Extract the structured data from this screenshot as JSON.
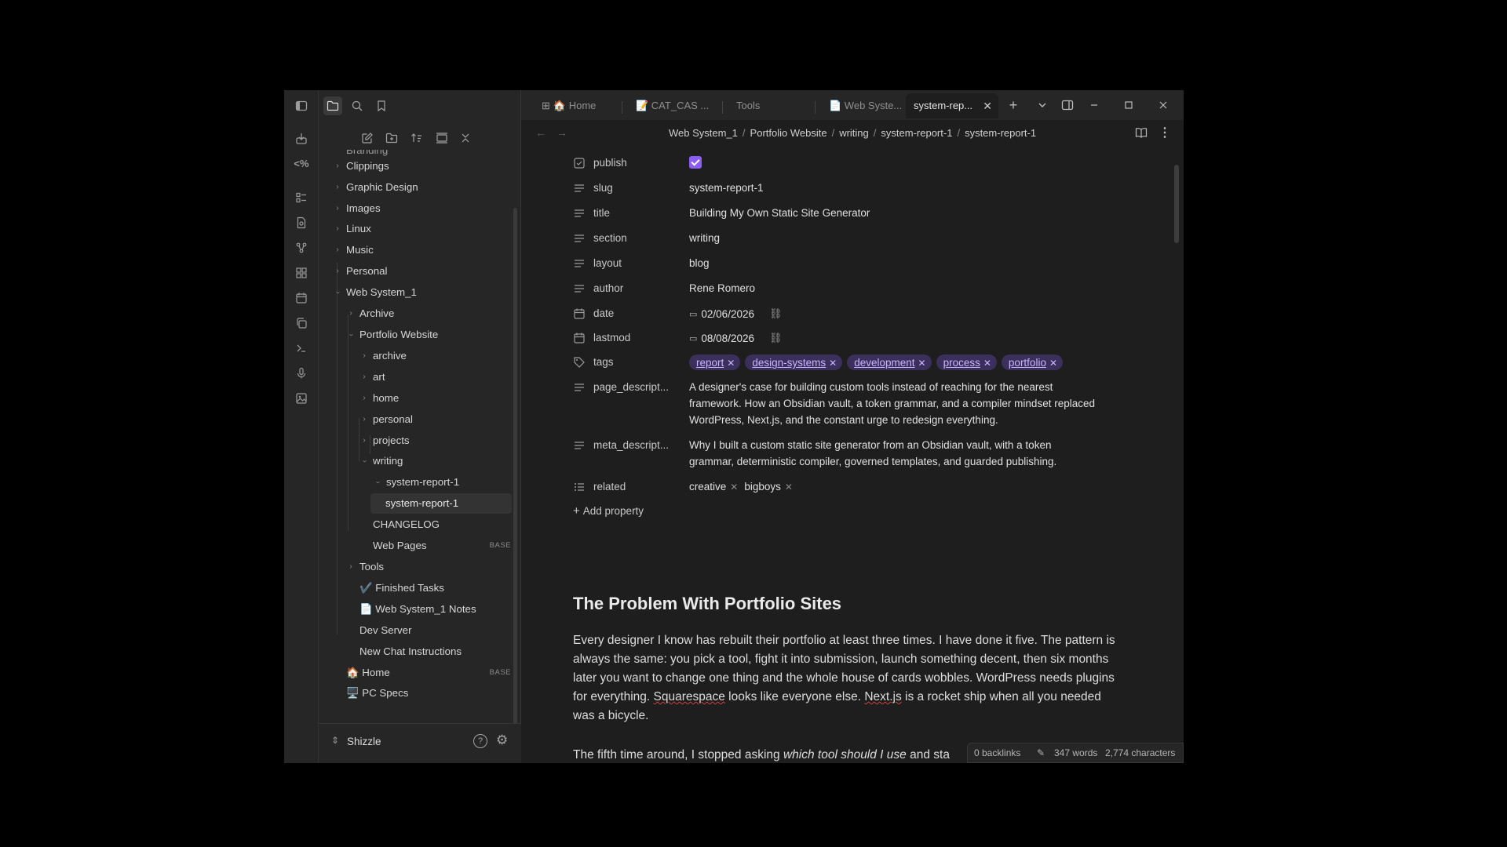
{
  "tabs": [
    {
      "icon": "⊞",
      "label": "🏠 Home"
    },
    {
      "icon": "",
      "label": "📝 CAT_CAS ..."
    },
    {
      "icon": "",
      "label": "Tools"
    },
    {
      "icon": "",
      "label": "📄 Web Syste..."
    },
    {
      "icon": "",
      "label": "system-rep..."
    }
  ],
  "breadcrumb": [
    "Web System_1",
    "Portfolio Website",
    "writing",
    "system-report-1",
    "system-report-1"
  ],
  "sidebar": {
    "tree": [
      {
        "label": "Branding"
      },
      {
        "label": "Clippings"
      },
      {
        "label": "Graphic Design"
      },
      {
        "label": "Images"
      },
      {
        "label": "Linux"
      },
      {
        "label": "Music"
      },
      {
        "label": "Personal"
      },
      {
        "label": "Web System_1"
      },
      {
        "label": "Archive"
      },
      {
        "label": "Portfolio Website"
      },
      {
        "label": "archive"
      },
      {
        "label": "art"
      },
      {
        "label": "home"
      },
      {
        "label": "personal"
      },
      {
        "label": "projects"
      },
      {
        "label": "writing"
      },
      {
        "label": "system-report-1"
      },
      {
        "label": "system-report-1"
      },
      {
        "label": "CHANGELOG"
      },
      {
        "label": "Web Pages",
        "badge": "BASE"
      },
      {
        "label": "Tools"
      },
      {
        "label": "✔️ Finished Tasks"
      },
      {
        "label": "📄 Web System_1 Notes"
      },
      {
        "label": "Dev Server"
      },
      {
        "label": "New Chat Instructions"
      },
      {
        "label": "🏠 Home",
        "badge": "BASE"
      },
      {
        "label": "🖥️ PC Specs"
      }
    ],
    "vault_name": "Shizzle"
  },
  "properties": {
    "publish": {
      "name": "publish",
      "checked": true
    },
    "slug": {
      "name": "slug",
      "value": "system-report-1"
    },
    "title": {
      "name": "title",
      "value": "Building My Own Static Site Generator"
    },
    "section": {
      "name": "section",
      "value": "writing"
    },
    "layout": {
      "name": "layout",
      "value": "blog"
    },
    "author": {
      "name": "author",
      "value": "Rene Romero"
    },
    "date": {
      "name": "date",
      "value": "02/06/2026"
    },
    "lastmod": {
      "name": "lastmod",
      "value": "08/08/2026"
    },
    "tags": {
      "name": "tags",
      "values": [
        "report",
        "design-systems",
        "development",
        "process",
        "portfolio"
      ]
    },
    "page_description": {
      "name": "page_descript...",
      "value": "A designer's case for building custom tools instead of reaching for the nearest framework. How an Obsidian vault, a token grammar, and a compiler mindset replaced WordPress, Next.js, and the constant urge to redesign everything."
    },
    "meta_description": {
      "name": "meta_descript...",
      "value": "Why I built a custom static site generator from an Obsidian vault, with a token grammar, deterministic compiler, governed templates, and guarded publishing."
    },
    "related": {
      "name": "related",
      "values": [
        "creative",
        "bigboys"
      ]
    },
    "add_property": "Add property"
  },
  "body": {
    "heading": "The Problem With Portfolio Sites",
    "p1_a": "Every designer I know has rebuilt their portfolio at least three times. I have done it five. The pattern is always the same: you pick a tool, fight it into submission, launch something decent, then six months later you want to change one thing and the whole house of cards wobbles. WordPress needs plugins for everything. ",
    "p1_spell1": "Squarespace",
    "p1_b": " looks like everyone else. ",
    "p1_spell2": "Next.js",
    "p1_c": " is a rocket ship when all you needed was a bicycle.",
    "p2_a": "The fifth time around, I stopped asking ",
    "p2_em": "which tool should I use",
    "p2_b": " and sta"
  },
  "status": {
    "backlinks": "0 backlinks",
    "words": "347 words",
    "characters": "2,774 characters"
  },
  "colors": {
    "accent": "#8b5cf6",
    "tag_bg": "#3b2f5c",
    "tag_fg": "#c8b5ff"
  }
}
